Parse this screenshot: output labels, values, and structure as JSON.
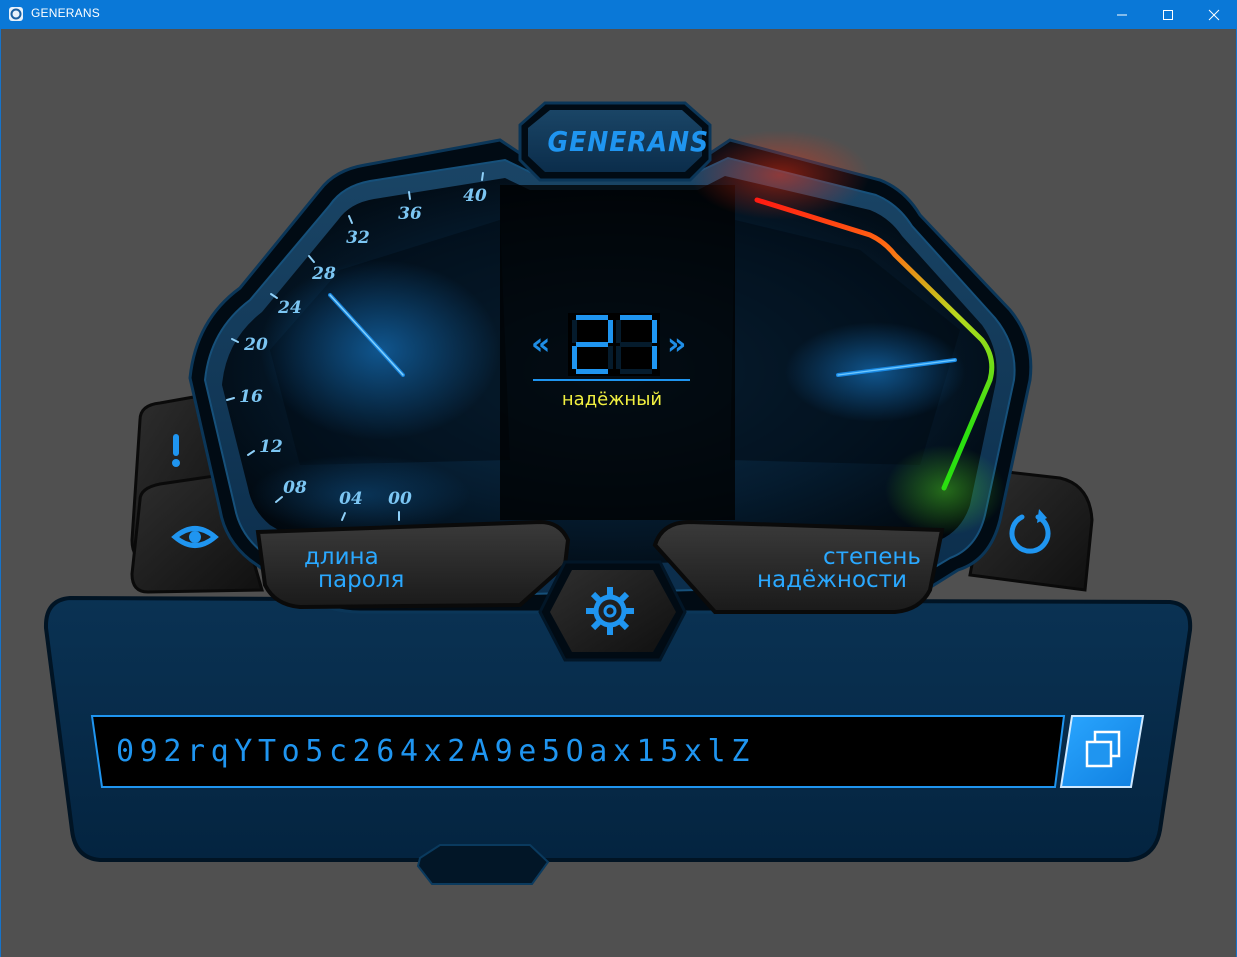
{
  "window": {
    "title": "GENERANS",
    "controls": [
      "minimize",
      "maximize",
      "close"
    ]
  },
  "dashboard": {
    "brand": "GENERANS",
    "length_gauge": {
      "label_line1": "длина",
      "label_line2": "пароля",
      "ticks": [
        "00",
        "04",
        "08",
        "12",
        "16",
        "20",
        "24",
        "28",
        "32",
        "36",
        "40"
      ],
      "value": 27
    },
    "strength_gauge": {
      "label_line1": "степень",
      "label_line2": "надёжности",
      "gradient_colors": [
        "#ff1a12",
        "#ff8a10",
        "#c8e020",
        "#2ae010"
      ]
    },
    "center": {
      "length_display": "27",
      "decrement_arrow": "«",
      "increment_arrow": "»",
      "strength_text": "надёжный"
    },
    "password": {
      "value": "092rqYTo5c264x2A9e5Oax15xlZ"
    },
    "icons": {
      "warning": "exclamation-icon",
      "show": "eye-icon",
      "refresh": "refresh-icon",
      "settings": "gear-icon",
      "copy": "copy-icon"
    },
    "colors": {
      "accent": "#1f95f0",
      "strength_text": "#f2f040",
      "panel": "#062a4a"
    }
  }
}
